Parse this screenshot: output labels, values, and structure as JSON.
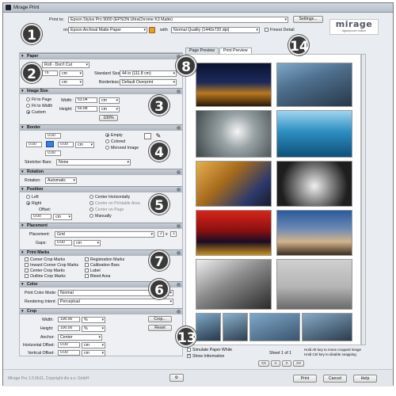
{
  "window": {
    "title": "Mirage Print"
  },
  "topbar": {
    "print_to_label": "Print to:",
    "printer": "Epson Stylus Pro 9000 (EPSON UltraChrome K3 Matte)",
    "settings_button": "Settings...",
    "on_label": "on",
    "paper": "Epson Archival Matte Paper",
    "with_label": "with",
    "quality": "Normal Quality (1440x720 dpi)",
    "finest_detail_label": "Finest Detail"
  },
  "logo": {
    "name": "mirage",
    "tagline": "digitalprinter edition"
  },
  "paper": {
    "header": "Paper",
    "roll": "Roll - Don't Cut",
    "width_value": "76",
    "width_unit": "cm",
    "standard_size_label": "Standard Size:",
    "standard_size": "44 in (111.8 cm)",
    "unit2": "cm",
    "borderless_label": "Borderless:",
    "borderless": "Default Overprint"
  },
  "image_size": {
    "header": "Image Size",
    "options": [
      "Fit to Page",
      "Fit to Width",
      "Custom"
    ],
    "width_label": "Width:",
    "width_value": "53.04",
    "width_unit": "cm",
    "height_label": "Height:",
    "height_value": "66.88",
    "height_unit": "cm",
    "percent_button": "100%"
  },
  "border": {
    "header": "Border",
    "top": "0.00",
    "left": "0.00",
    "right": "0.00",
    "bottom": "0.00",
    "unit": "cm",
    "options": [
      "Empty",
      "Colored",
      "Mirrored Image"
    ],
    "stretcher_label": "Stretcher Bars:",
    "stretcher": "None"
  },
  "rotation": {
    "header": "Rotation",
    "label": "Rotation:",
    "value": "Automatic"
  },
  "position": {
    "header": "Position",
    "left_options": [
      "Left",
      "Right"
    ],
    "offset_label": "Offset:",
    "offset_value": "0.00",
    "offset_unit": "cm",
    "right_options": [
      "Center Horizontally",
      "Center on Printable Area",
      "Center on Page",
      "Manually"
    ]
  },
  "placement": {
    "header": "Placement",
    "label": "Placement:",
    "value": "Grid",
    "cols": "2",
    "x": "x",
    "rows": "1",
    "gaps_label": "Gaps:",
    "gaps_value": "0.00",
    "gaps_unit": "cm"
  },
  "print_marks": {
    "header": "Print Marks",
    "left": [
      "Corner Crop Marks",
      "Inward Corner Crop Marks",
      "Center Crop Marks",
      "Outline Crop Marks"
    ],
    "right": [
      "Registration Marks",
      "Calibration Bars",
      "Label",
      "Bleed Area"
    ]
  },
  "color": {
    "header": "Color",
    "mode_label": "Print Color Mode:",
    "mode": "Normal",
    "intent_label": "Rendering Intent:",
    "intent": "Perceptual"
  },
  "crop": {
    "header": "Crop",
    "width_label": "Width:",
    "width_value": "100.00",
    "width_unit": "%",
    "height_label": "Height:",
    "height_value": "100.00",
    "height_unit": "%",
    "crop_button": "Crop...",
    "reset_button": "Reset",
    "anchor_label": "Anchor:",
    "anchor": "Center",
    "hoffset_label": "Horizontal Offset:",
    "hoffset_value": "0.00",
    "hoffset_unit": "cm",
    "voffset_label": "Vertical Offset:",
    "voffset_value": "0.00",
    "voffset_unit": "cm"
  },
  "preview": {
    "tabs": [
      "Page Preview",
      "Print Preview"
    ],
    "simulate_label": "Simulate Paper White",
    "show_info_label": "Show Information",
    "sheet": "Sheet 1 of 1",
    "hint1": "Hold Alt key to move cropped image",
    "hint2": "Hold Ctrl key to disable snapping",
    "nav": [
      "<<",
      "<",
      ">",
      ">>"
    ]
  },
  "footer": {
    "copyright": "Mirage Pro 1.5.0b11, Copyright dts a.s. GmbH",
    "print_button": "Print",
    "cancel_button": "Cancel",
    "help_button": "Help"
  },
  "badges": [
    "1",
    "2",
    "3",
    "4",
    "5",
    "6",
    "7",
    "8",
    "13",
    "14"
  ]
}
